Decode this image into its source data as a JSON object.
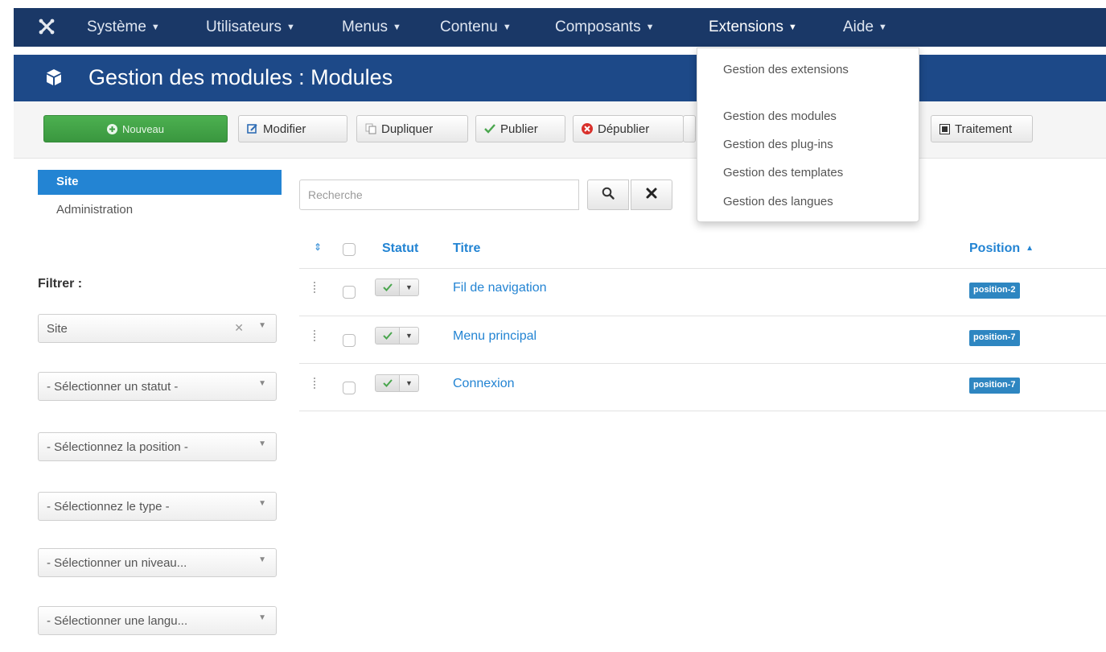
{
  "navbar": {
    "logo_icon": "joomla-logo-icon",
    "items": [
      {
        "label": "Système"
      },
      {
        "label": "Utilisateurs"
      },
      {
        "label": "Menus"
      },
      {
        "label": "Contenu"
      },
      {
        "label": "Composants"
      },
      {
        "label": "Extensions"
      },
      {
        "label": "Aide"
      }
    ]
  },
  "header": {
    "icon": "cube-icon",
    "title": "Gestion des modules : Modules"
  },
  "toolbar": {
    "new_label": "Nouveau",
    "edit_label": "Modifier",
    "duplicate_label": "Dupliquer",
    "publish_label": "Publier",
    "unpublish_label": "Dépublier",
    "batch_label": "Traitement"
  },
  "sidebar": {
    "items": [
      {
        "label": "Site",
        "active": true
      },
      {
        "label": "Administration",
        "active": false
      }
    ],
    "filter_title": "Filtrer :",
    "filters": [
      {
        "value": "Site"
      },
      {
        "value": "- Sélectionner un statut -"
      },
      {
        "value": "- Sélectionnez la position -"
      },
      {
        "value": "- Sélectionnez le type -"
      },
      {
        "value": "- Sélectionner un niveau..."
      },
      {
        "value": "- Sélectionner une langu..."
      }
    ]
  },
  "search": {
    "placeholder": "Recherche"
  },
  "table": {
    "headers": {
      "status": "Statut",
      "title": "Titre",
      "position": "Position"
    },
    "rows": [
      {
        "title": "Fil de navigation",
        "position": "position-2",
        "published": true
      },
      {
        "title": "Menu principal",
        "position": "position-7",
        "published": true
      },
      {
        "title": "Connexion",
        "position": "position-7",
        "published": true
      }
    ]
  },
  "extensions_menu": {
    "items": [
      {
        "label": "Gestion des extensions"
      },
      {
        "label": "Gestion des modules"
      },
      {
        "label": "Gestion des plug-ins"
      },
      {
        "label": "Gestion des templates"
      },
      {
        "label": "Gestion des langues"
      }
    ]
  },
  "colors": {
    "navbar": "#1a3867",
    "titlebar": "#1d4988",
    "accent": "#2384d3",
    "new_button": "#46a84b",
    "badge": "#2e86c1"
  }
}
